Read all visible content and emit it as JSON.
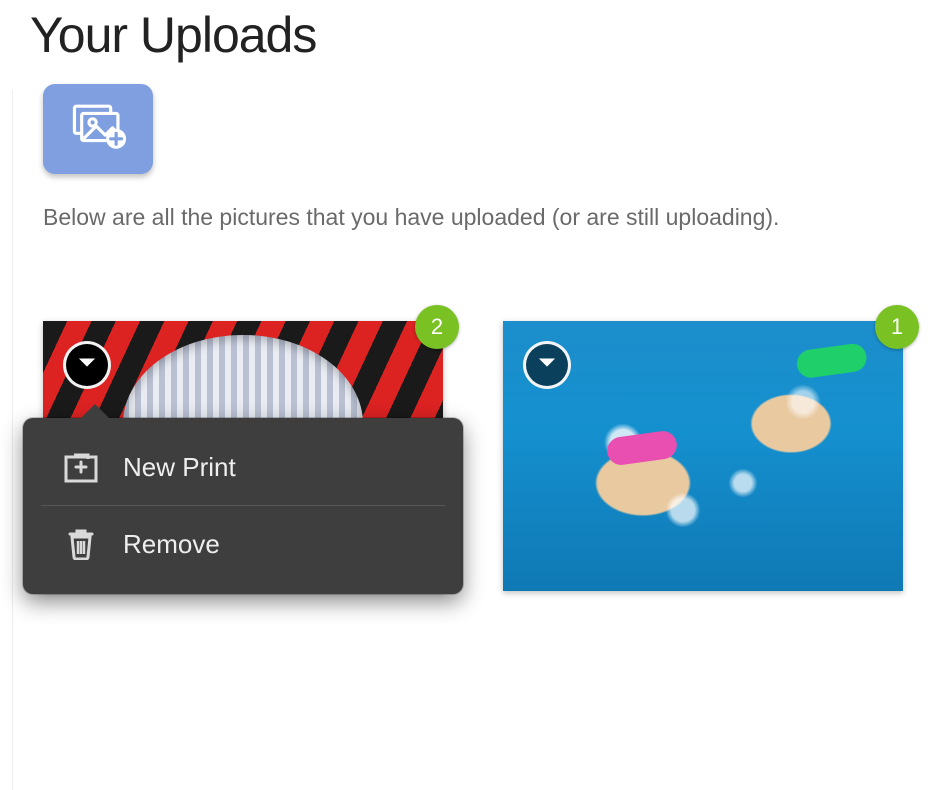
{
  "header": {
    "title": "Your Uploads",
    "description": "Below are all the pictures that you have uploaded (or are still uploading)."
  },
  "upload_button": {
    "name": "add-photos"
  },
  "thumbs": [
    {
      "badge": "2",
      "menu_open": true
    },
    {
      "badge": "1",
      "menu_open": false
    }
  ],
  "menu": {
    "items": [
      {
        "icon": "new-print-icon",
        "label": "New Print"
      },
      {
        "icon": "trash-icon",
        "label": "Remove"
      }
    ]
  }
}
